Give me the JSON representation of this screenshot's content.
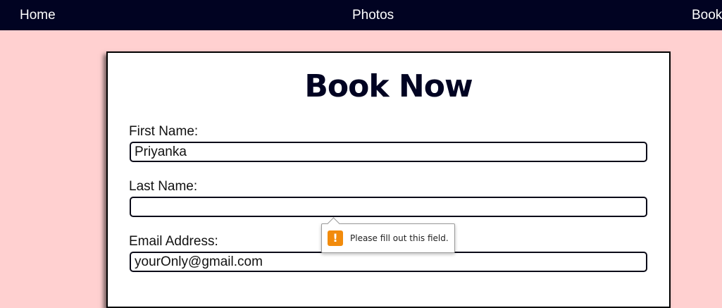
{
  "nav": {
    "home": "Home",
    "photos": "Photos",
    "book": "Book"
  },
  "form": {
    "title": "Book Now",
    "first_name": {
      "label": "First Name:",
      "value": "Priyanka"
    },
    "last_name": {
      "label": "Last Name:",
      "value": ""
    },
    "email": {
      "label": "Email Address:",
      "value": "yourOnly@gmail.com"
    }
  },
  "validation": {
    "message": "Please fill out this field.",
    "icon": "warning-icon"
  },
  "colors": {
    "navbar": "#010322",
    "page_background": "#ffd0d0",
    "warning": "#f28b0c"
  }
}
